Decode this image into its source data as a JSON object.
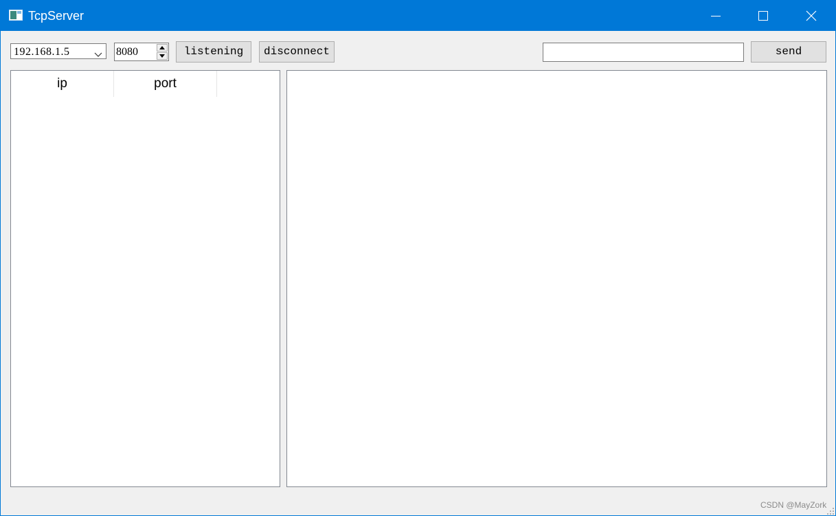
{
  "window": {
    "title": "TcpServer",
    "title_bar_color": "#0078d7",
    "controls": [
      "minimize-icon",
      "maximize-icon",
      "close-icon"
    ]
  },
  "toolbar": {
    "ip_select": {
      "selected": "192.168.1.5"
    },
    "port_spinbox": {
      "value": "8080"
    },
    "listening_label": "listening",
    "disconnect_label": "disconnect",
    "send_input": {
      "value": ""
    },
    "send_label": "send"
  },
  "client_table": {
    "columns": [
      "ip",
      "port"
    ],
    "rows": []
  },
  "message_area": {
    "content": ""
  },
  "watermark": "CSDN @MayZork"
}
